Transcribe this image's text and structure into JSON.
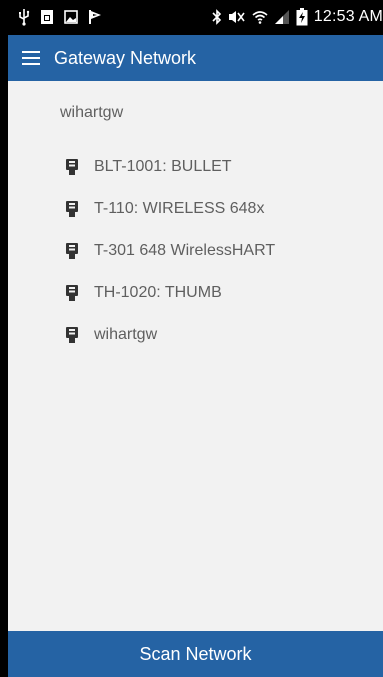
{
  "status_bar": {
    "time": "12:53 AM",
    "left_icons": [
      "usb-icon",
      "sim-card-icon",
      "image-icon",
      "flag-icon"
    ],
    "right_icons": [
      "bluetooth-icon",
      "mute-icon",
      "wifi-icon",
      "signal-icon",
      "battery-charging-icon"
    ]
  },
  "app_bar": {
    "title": "Gateway Network",
    "menu_icon": "hamburger-menu-icon"
  },
  "network": {
    "header": "wihartgw",
    "devices": [
      {
        "label": "BLT-1001: BULLET",
        "icon": "device-icon"
      },
      {
        "label": "T-110: WIRELESS 648x",
        "icon": "device-icon"
      },
      {
        "label": "T-301 648 WirelessHART",
        "icon": "device-icon"
      },
      {
        "label": "TH-1020: THUMB",
        "icon": "device-icon"
      },
      {
        "label": "wihartgw",
        "icon": "device-icon"
      }
    ]
  },
  "footer": {
    "scan_label": "Scan Network"
  },
  "colors": {
    "primary": "#2563a4",
    "background": "#f2f2f2",
    "text": "#5f5f5f"
  }
}
